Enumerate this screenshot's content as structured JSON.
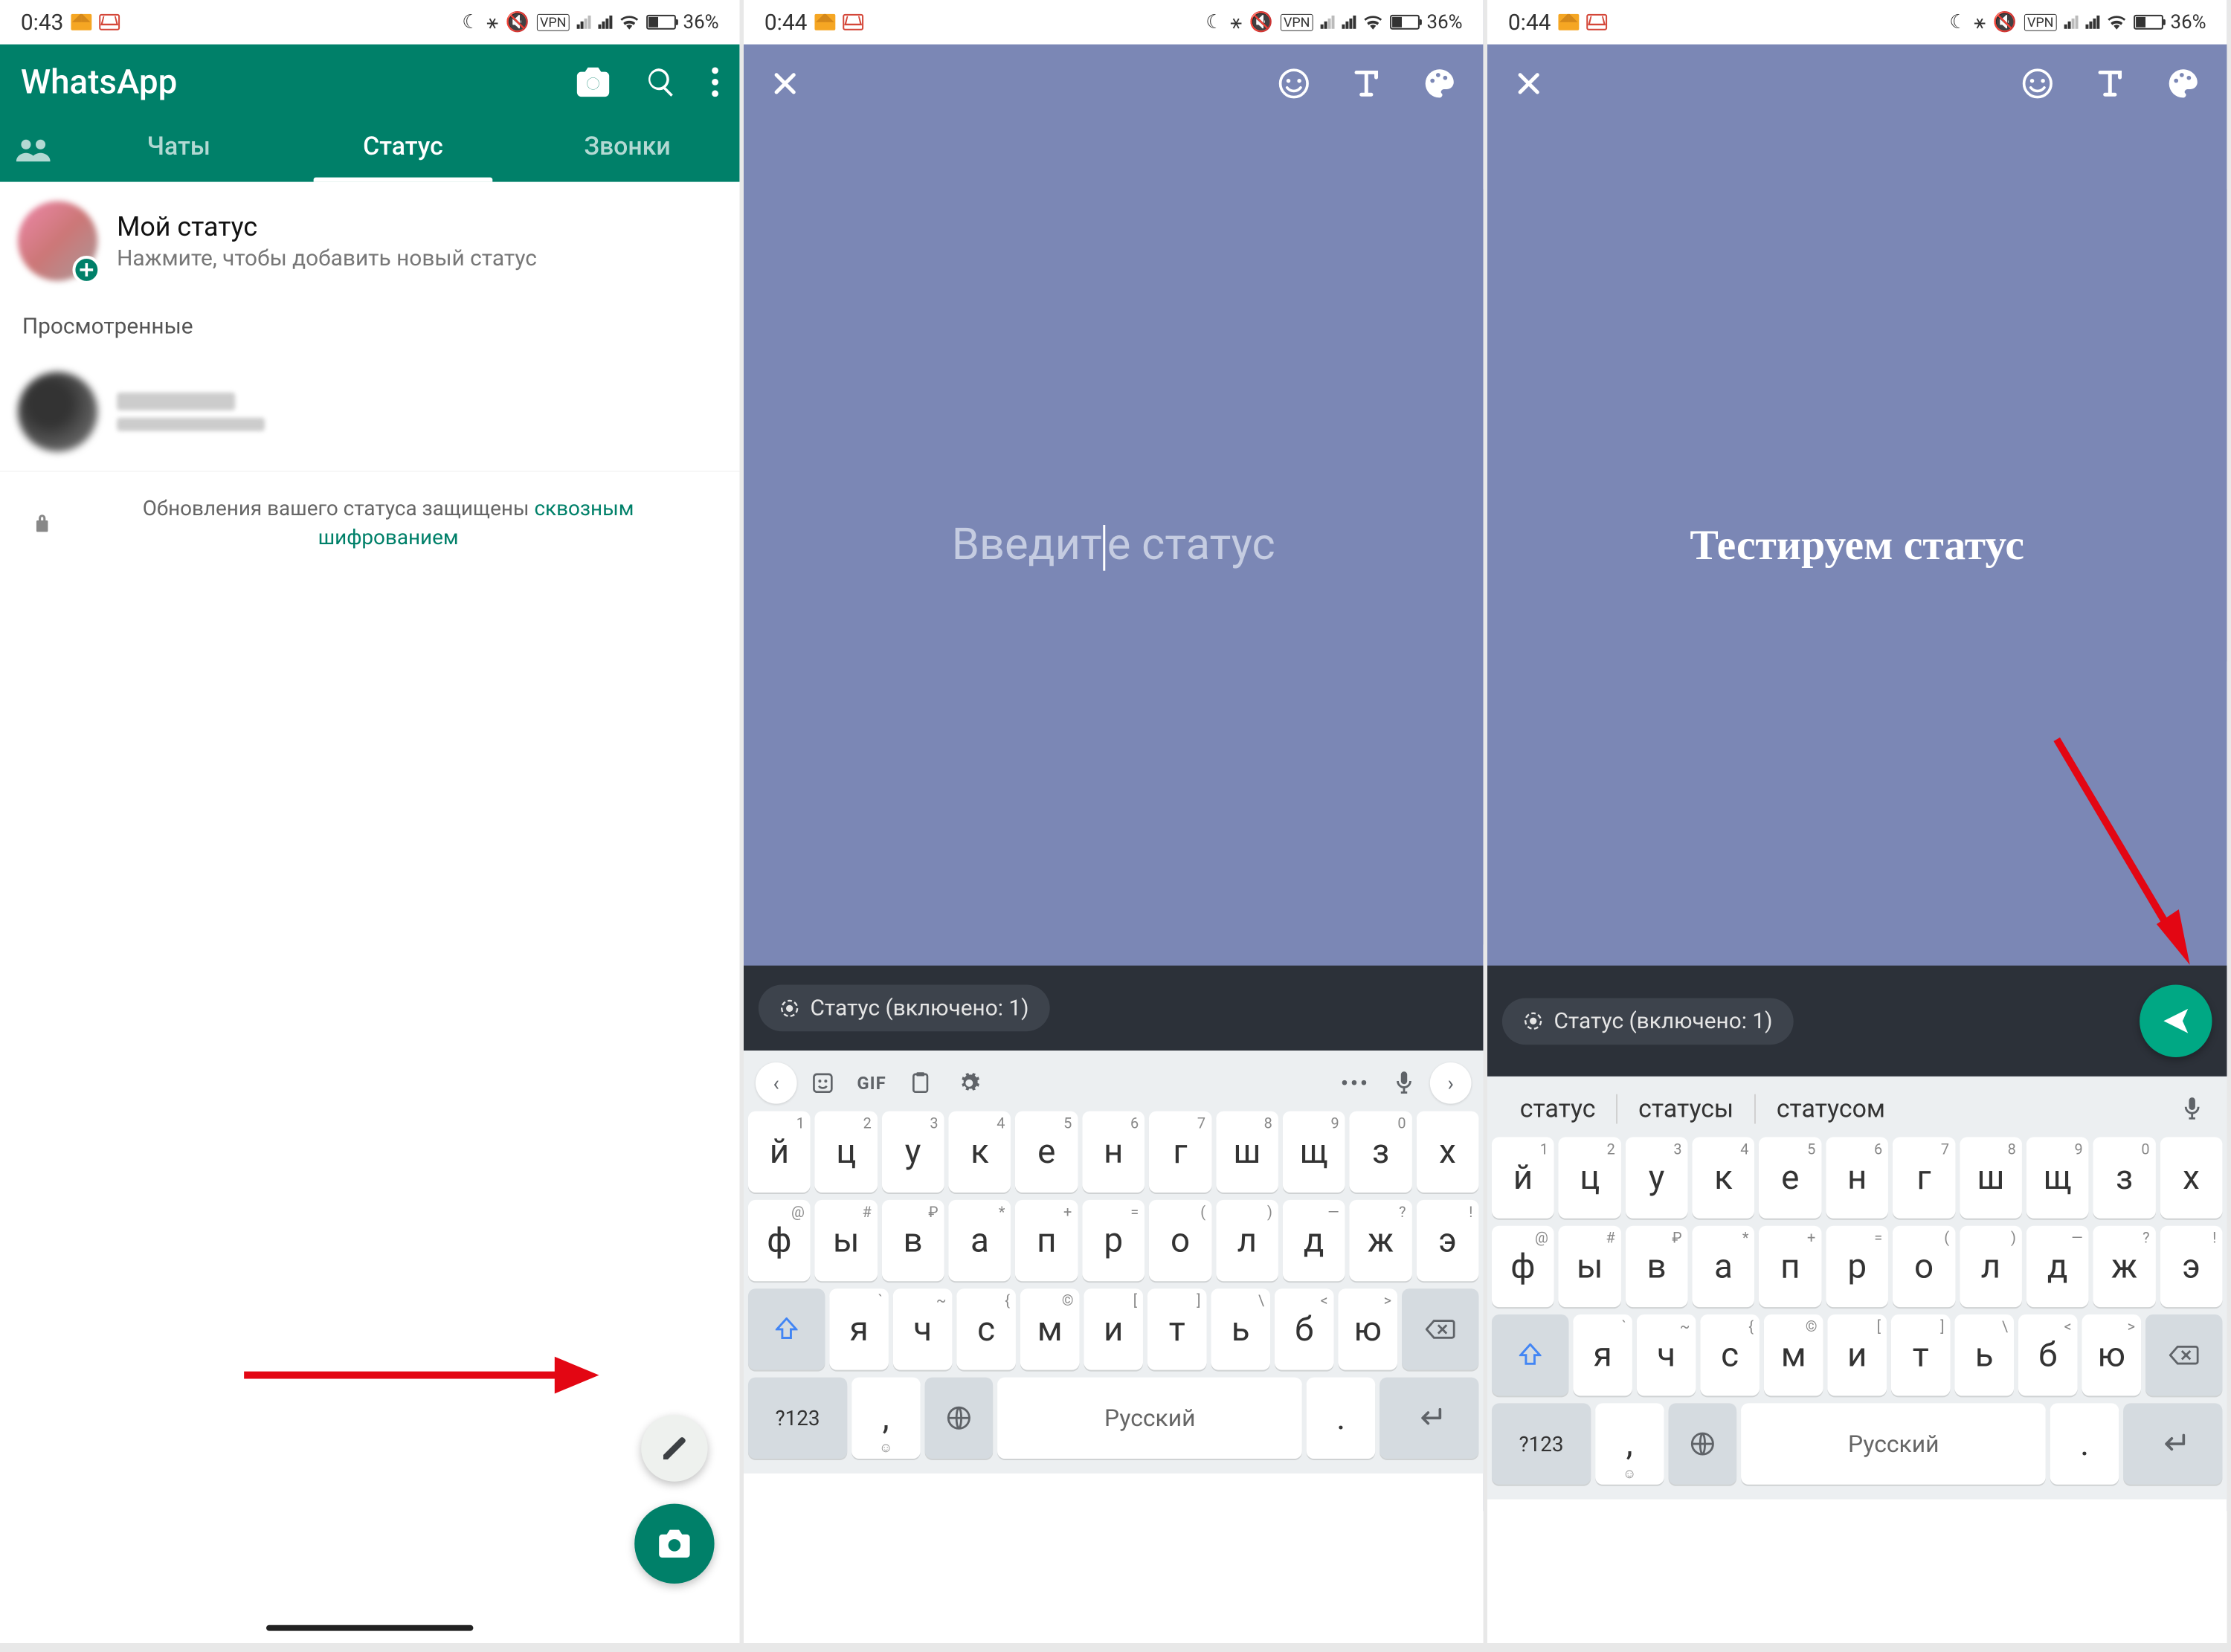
{
  "statusbar": {
    "time1": "0:43",
    "time2": "0:44",
    "battery": "36%",
    "vpn": "VPN"
  },
  "screen1": {
    "app_title": "WhatsApp",
    "tabs": {
      "chats": "Чаты",
      "status": "Статус",
      "calls": "Звонки"
    },
    "my_status_title": "Мой статус",
    "my_status_sub": "Нажмите, чтобы добавить новый статус",
    "viewed_label": "Просмотренные",
    "encryption_pre": "Обновления вашего статуса защищены ",
    "encryption_link": "сквозным шифрованием"
  },
  "screen2": {
    "placeholder_a": "Введит",
    "placeholder_b": "е статус",
    "chip_label": "Статус (включено: 1)"
  },
  "screen3": {
    "typed_text": "Тестируем статус",
    "chip_label": "Статус (включено: 1)"
  },
  "keyboard": {
    "suggestions": [
      "статус",
      "статусы",
      "статусом"
    ],
    "gif": "GIF",
    "sym": "?123",
    "space": "Русский",
    "row1": [
      {
        "k": "й",
        "s": "1"
      },
      {
        "k": "ц",
        "s": "2"
      },
      {
        "k": "у",
        "s": "3"
      },
      {
        "k": "к",
        "s": "4"
      },
      {
        "k": "е",
        "s": "5"
      },
      {
        "k": "н",
        "s": "6"
      },
      {
        "k": "г",
        "s": "7"
      },
      {
        "k": "ш",
        "s": "8"
      },
      {
        "k": "щ",
        "s": "9"
      },
      {
        "k": "з",
        "s": "0"
      },
      {
        "k": "х",
        "s": ""
      }
    ],
    "row2": [
      {
        "k": "ф",
        "s": "@"
      },
      {
        "k": "ы",
        "s": "#"
      },
      {
        "k": "в",
        "s": "₽"
      },
      {
        "k": "а",
        "s": "*"
      },
      {
        "k": "п",
        "s": "+"
      },
      {
        "k": "р",
        "s": "="
      },
      {
        "k": "о",
        "s": "("
      },
      {
        "k": "л",
        "s": ")"
      },
      {
        "k": "д",
        "s": "—"
      },
      {
        "k": "ж",
        "s": "?"
      },
      {
        "k": "э",
        "s": "!"
      }
    ],
    "row3": [
      {
        "k": "я",
        "s": "`"
      },
      {
        "k": "ч",
        "s": "~"
      },
      {
        "k": "с",
        "s": "{"
      },
      {
        "k": "м",
        "s": "©"
      },
      {
        "k": "и",
        "s": "["
      },
      {
        "k": "т",
        "s": "]"
      },
      {
        "k": "ь",
        "s": "\\"
      },
      {
        "k": "б",
        "s": "<"
      },
      {
        "k": "ю",
        "s": ">"
      }
    ]
  }
}
